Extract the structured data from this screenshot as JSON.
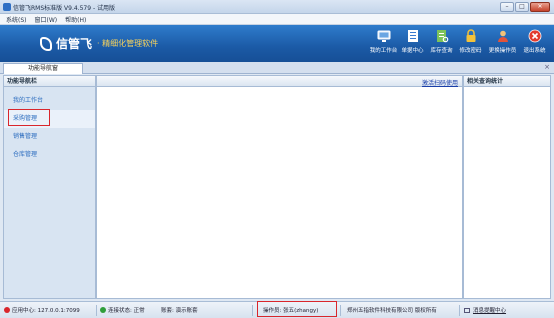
{
  "window": {
    "title": "信管飞RMS标准版 V9.4.579 - 试用版",
    "controls": [
      "–",
      "□",
      "✕"
    ]
  },
  "menu": [
    "系统(S)",
    "窗口(W)",
    "帮助(H)"
  ],
  "banner": {
    "brand": "信管飞",
    "slogan": "· 精细化管理软件",
    "colors": {
      "banner": "#1b5aa6",
      "slogan": "#f7d25c"
    }
  },
  "toolbar": [
    {
      "label": "我的工作台",
      "icon": "monitor-icon"
    },
    {
      "label": "单据中心",
      "icon": "document-list-icon"
    },
    {
      "label": "库存查询",
      "icon": "inventory-search-icon"
    },
    {
      "label": "修改密码",
      "icon": "lock-icon"
    },
    {
      "label": "更换操作员",
      "icon": "user-switch-icon"
    },
    {
      "label": "退出系统",
      "icon": "exit-icon"
    }
  ],
  "tab": {
    "label": "功能导航窗",
    "close": "×"
  },
  "sidebar": {
    "title": "功能导航栏",
    "items": [
      {
        "label": "我的工作台"
      },
      {
        "label": "采购管理"
      },
      {
        "label": "销售管理"
      },
      {
        "label": "仓库管理"
      }
    ]
  },
  "content": {
    "link": "激活扫码使用"
  },
  "stats": {
    "title": "相关查询统计"
  },
  "status": {
    "app_center": "应用中心: 127.0.0.1:7099",
    "connection": "连接状态: 正常",
    "account": "账套: 演示账套",
    "operator": "操作员: 张五(zhangy)",
    "company": "郑州五指软件科技有限公司 版权所有",
    "reminder": "消息提醒中心"
  }
}
